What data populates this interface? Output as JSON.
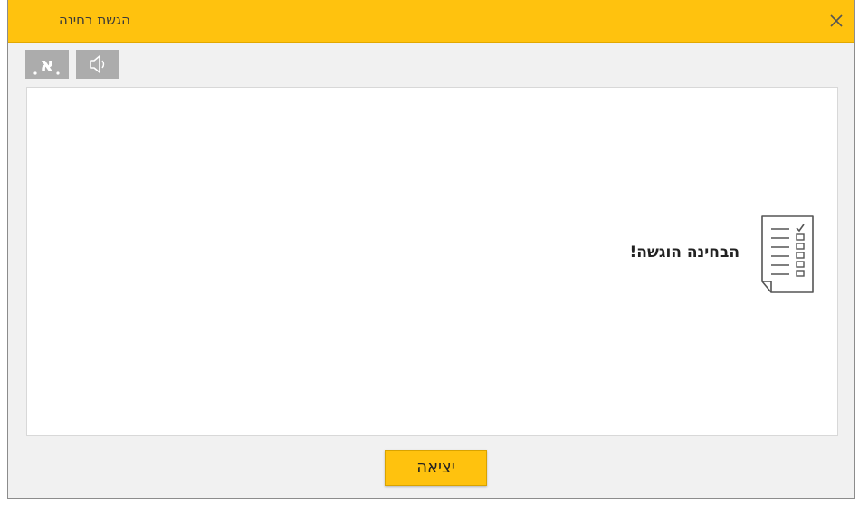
{
  "window": {
    "title": "הגשת בחינה",
    "accent_color": "#ffc20e"
  },
  "titlebar": {
    "close_icon": "close-icon"
  },
  "toolbar": {
    "font_size_button_label": "א",
    "font_size_icon": "font-size-icon",
    "sound_icon": "speaker-icon"
  },
  "content": {
    "icon": "document-checklist-icon",
    "message": "הבחינה הוגשה!"
  },
  "footer": {
    "exit_label": "יציאה"
  }
}
